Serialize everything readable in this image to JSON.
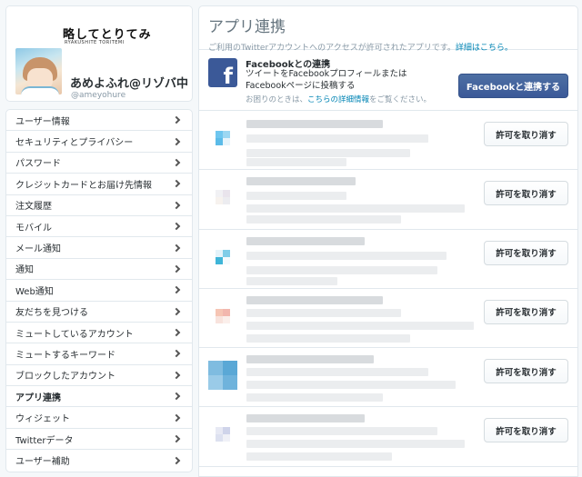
{
  "profile": {
    "banner_title": "略してとりてみ",
    "banner_sub": "RYAKUSHITE TORITEMI",
    "name": "あめよふれ@リゾバ中",
    "handle": "@ameyohure"
  },
  "nav": [
    {
      "label": "ユーザー情報",
      "active": false
    },
    {
      "label": "セキュリティとプライバシー",
      "active": false
    },
    {
      "label": "パスワード",
      "active": false
    },
    {
      "label": "クレジットカードとお届け先情報",
      "active": false
    },
    {
      "label": "注文履歴",
      "active": false
    },
    {
      "label": "モバイル",
      "active": false
    },
    {
      "label": "メール通知",
      "active": false
    },
    {
      "label": "通知",
      "active": false
    },
    {
      "label": "Web通知",
      "active": false
    },
    {
      "label": "友だちを見つける",
      "active": false
    },
    {
      "label": "ミュートしているアカウント",
      "active": false
    },
    {
      "label": "ミュートするキーワード",
      "active": false
    },
    {
      "label": "ブロックしたアカウント",
      "active": false
    },
    {
      "label": "アプリ連携",
      "active": true
    },
    {
      "label": "ウィジェット",
      "active": false
    },
    {
      "label": "Twitterデータ",
      "active": false
    },
    {
      "label": "ユーザー補助",
      "active": false
    }
  ],
  "main": {
    "title": "アプリ連携",
    "description": "ご利用のTwitterアカウントへのアクセスが許可されたアプリです。",
    "details_link": "詳細はこちら。"
  },
  "facebook": {
    "icon_glyph": "f",
    "title": "Facebookとの連携",
    "desc_line1": "ツイートをFacebookプロフィールまたは",
    "desc_line2": "Facebookページに投稿する",
    "help_prefix": "お困りのときは、",
    "help_link": "こちらの詳細情報",
    "help_suffix": "をご覧ください。",
    "button_label": "Facebookと連携する"
  },
  "apps": [
    {
      "revoke_label": "許可を取り消す",
      "colors": [
        "#6ec6ef",
        "#9bd7f2",
        "#5bbbe8",
        "#e6f4fb"
      ]
    },
    {
      "revoke_label": "許可を取り消す",
      "colors": [
        "#f1f1f4",
        "#e9e4ec",
        "#f7f2ee",
        "#ececf0"
      ]
    },
    {
      "revoke_label": "許可を取り消す",
      "colors": [
        "#e4f3fa",
        "#7fcde8",
        "#3fb5d8",
        "#f4fafd"
      ]
    },
    {
      "revoke_label": "許可を取り消す",
      "colors": [
        "#f6c5b4",
        "#f2b7ae",
        "#f8e3dd",
        "#fbefeb"
      ]
    },
    {
      "revoke_label": "許可を取り消す",
      "colors": [
        "#7fbce0",
        "#5aa8d6",
        "#9acbe8",
        "#6fb3dc"
      ]
    },
    {
      "revoke_label": "許可を取り消す",
      "colors": [
        "#e7e9f4",
        "#cfd4ea",
        "#dde1f0",
        "#f0f1f7"
      ]
    }
  ]
}
